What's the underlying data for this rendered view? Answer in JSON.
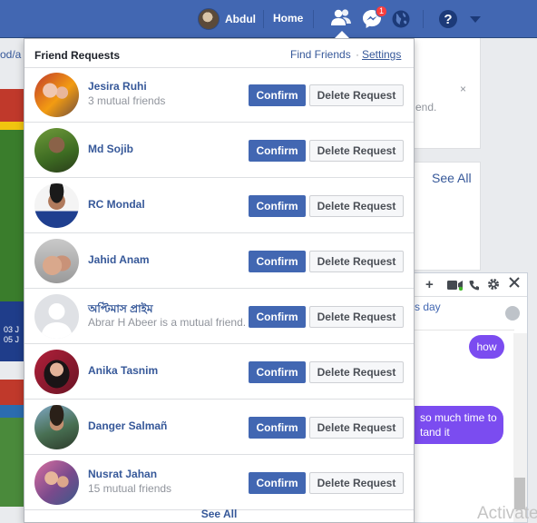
{
  "topbar": {
    "user_name": "Abdul",
    "home_label": "Home",
    "messages_badge": "1"
  },
  "background": {
    "link_fragment": "od/a",
    "see_all": "See All",
    "card_text_fragment": "end.",
    "close_glyph": "×",
    "ad_text_line1": "03 J",
    "ad_text_line2": "05 J"
  },
  "chat": {
    "day_text": "s day",
    "bubble_how": "how",
    "bubble_long_line1": "so much time to",
    "bubble_long_line2": "tand it"
  },
  "watermark": "Activate",
  "friend_requests": {
    "title": "Friend Requests",
    "find_friends": "Find Friends",
    "separator": "·",
    "settings": "Settings",
    "confirm_label": "Confirm",
    "delete_label": "Delete Request",
    "see_all": "See All",
    "requests": [
      {
        "name": "Jesira Ruhi",
        "subtitle": "3 mutual friends"
      },
      {
        "name": "Md Sojib",
        "subtitle": ""
      },
      {
        "name": "RC Mondal",
        "subtitle": ""
      },
      {
        "name": "Jahid Anam",
        "subtitle": ""
      },
      {
        "name": "অপ্টিমাস প্রাইম",
        "subtitle": "Abrar H Abeer is a mutual friend."
      },
      {
        "name": "Anika Tasnim",
        "subtitle": ""
      },
      {
        "name": "Danger Salmañ",
        "subtitle": ""
      },
      {
        "name": "Nusrat Jahan",
        "subtitle": "15 mutual friends"
      }
    ]
  },
  "colors": {
    "topbar": "#4267b2",
    "confirm_button": "#4267b2",
    "link": "#365899",
    "chat_bubble": "#7b4cf0",
    "badge": "#fa3e3e"
  },
  "icons": [
    "friends-icon",
    "messenger-icon",
    "globe-icon",
    "help-icon",
    "chevron-down-icon",
    "close-icon",
    "plus-icon",
    "video-icon",
    "phone-icon",
    "gear-icon"
  ]
}
